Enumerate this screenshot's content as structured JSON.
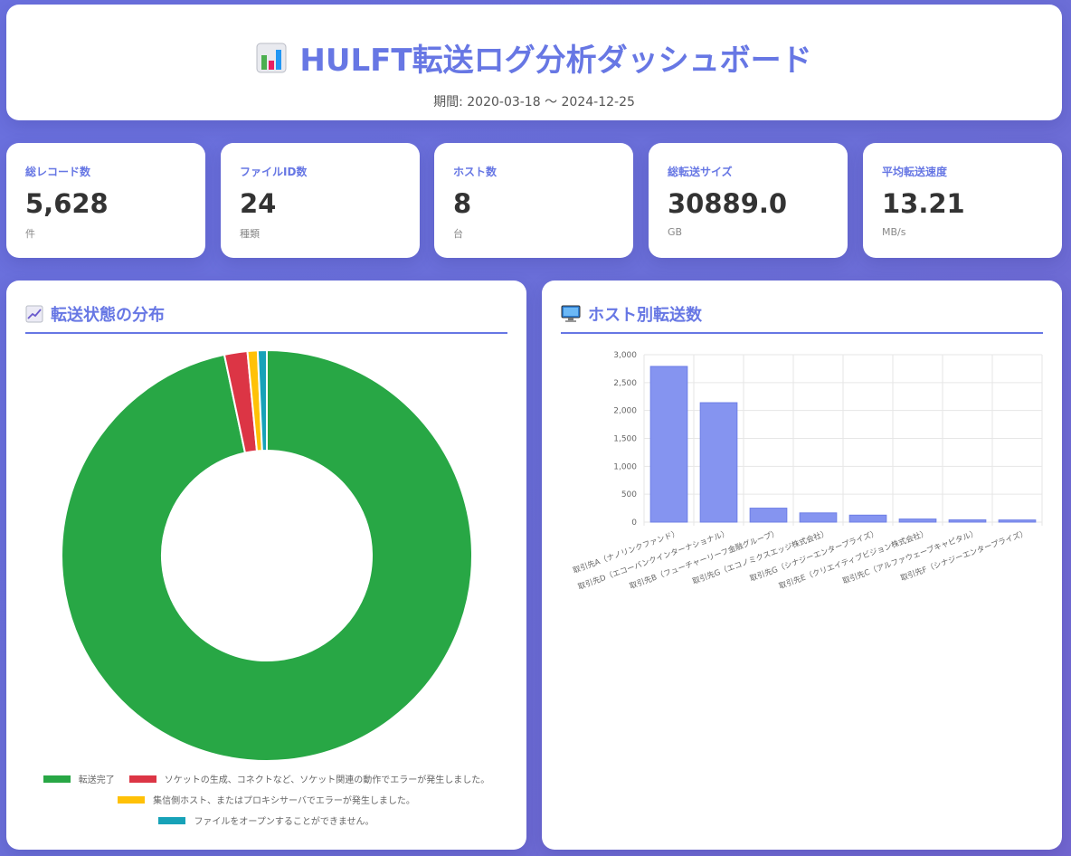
{
  "header": {
    "title": "HULFT転送ログ分析ダッシュボード",
    "period": "期間: 2020-03-18 〜 2024-12-25",
    "icon": "bar-chart-icon"
  },
  "stats": [
    {
      "label": "総レコード数",
      "value": "5,628",
      "unit": "件"
    },
    {
      "label": "ファイルID数",
      "value": "24",
      "unit": "種類"
    },
    {
      "label": "ホスト数",
      "value": "8",
      "unit": "台"
    },
    {
      "label": "総転送サイズ",
      "value": "30889.0",
      "unit": "GB"
    },
    {
      "label": "平均転送速度",
      "value": "13.21",
      "unit": "MB/s"
    }
  ],
  "status_panel": {
    "title": "転送状態の分布",
    "icon": "trend-chart-icon"
  },
  "host_panel": {
    "title": "ホスト別転送数",
    "icon": "monitor-icon"
  },
  "colors": {
    "accent": "#6777e4",
    "bar": "#8594f0"
  },
  "chart_data": [
    {
      "type": "pie",
      "title": "",
      "categories": [
        "転送完了",
        "ソケットの生成、コネクトなど、ソケット関連の動作でエラーが発生しました。",
        "集信側ホスト、またはプロキシサーバでエラーが発生しました。",
        "ファイルをオープンすることができません。"
      ],
      "values": [
        5441,
        102,
        45,
        40
      ],
      "colors": [
        "#28a745",
        "#dc3545",
        "#ffc107",
        "#17a2b8"
      ],
      "legend": "bottom"
    },
    {
      "type": "bar",
      "title": "",
      "xlabel": "",
      "ylabel": "",
      "categories": [
        "取引先A（ナノリンクファンド）",
        "取引先D（エコーバンクインターナショナル）",
        "取引先B（フューチャーリーフ金融グループ）",
        "取引先G（エコノミクスエッジ株式会社）",
        "取引先G（シナジーエンタープライズ）",
        "取引先E（クリエイティブビジョン株式会社）",
        "取引先C（アルファウェーブキャピタル）",
        "取引先F（シナジーエンタープライズ）"
      ],
      "values": [
        2790,
        2140,
        250,
        165,
        125,
        55,
        40,
        38
      ],
      "ylim": [
        0,
        3000
      ],
      "yticks": [
        "0",
        "500",
        "1,000",
        "1,500",
        "2,000",
        "2,500",
        "3,000"
      ],
      "grid": true
    }
  ]
}
